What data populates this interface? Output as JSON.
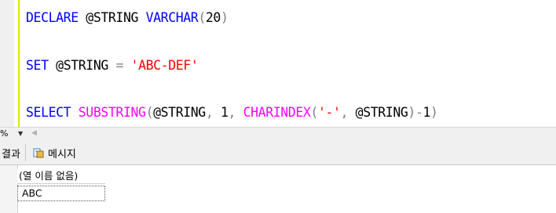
{
  "editor": {
    "line1": {
      "kw1": "DECLARE",
      "var": "@STRING",
      "type": "VARCHAR",
      "open": "(",
      "size": "20",
      "close": ")"
    },
    "line2": {
      "kw": "SET",
      "var": "@STRING",
      "eq": "=",
      "str": "'ABC-DEF'"
    },
    "line3": {
      "kw": "SELECT",
      "fn1": "SUBSTRING",
      "p1": "(",
      "var1": "@STRING",
      "c1": ",",
      "n1": "1",
      "c2": ",",
      "fn2": "CHARINDEX",
      "p2": "(",
      "str": "'-'",
      "c3": ",",
      "var2": "@STRING",
      "p3": ")",
      "minus": "-",
      "n2": "1",
      "p4": ")"
    }
  },
  "zoombar": {
    "zoom": "%",
    "dropdown_arrow": "▼",
    "scroll_left": "◀"
  },
  "results_tabs": {
    "results_label": "결과",
    "messages_label": "메시지"
  },
  "grid": {
    "column_header": "(열 이름 없음)",
    "rows": [
      [
        "ABC"
      ]
    ]
  },
  "icons": {
    "messages_tab_icon": "messages-icon"
  }
}
